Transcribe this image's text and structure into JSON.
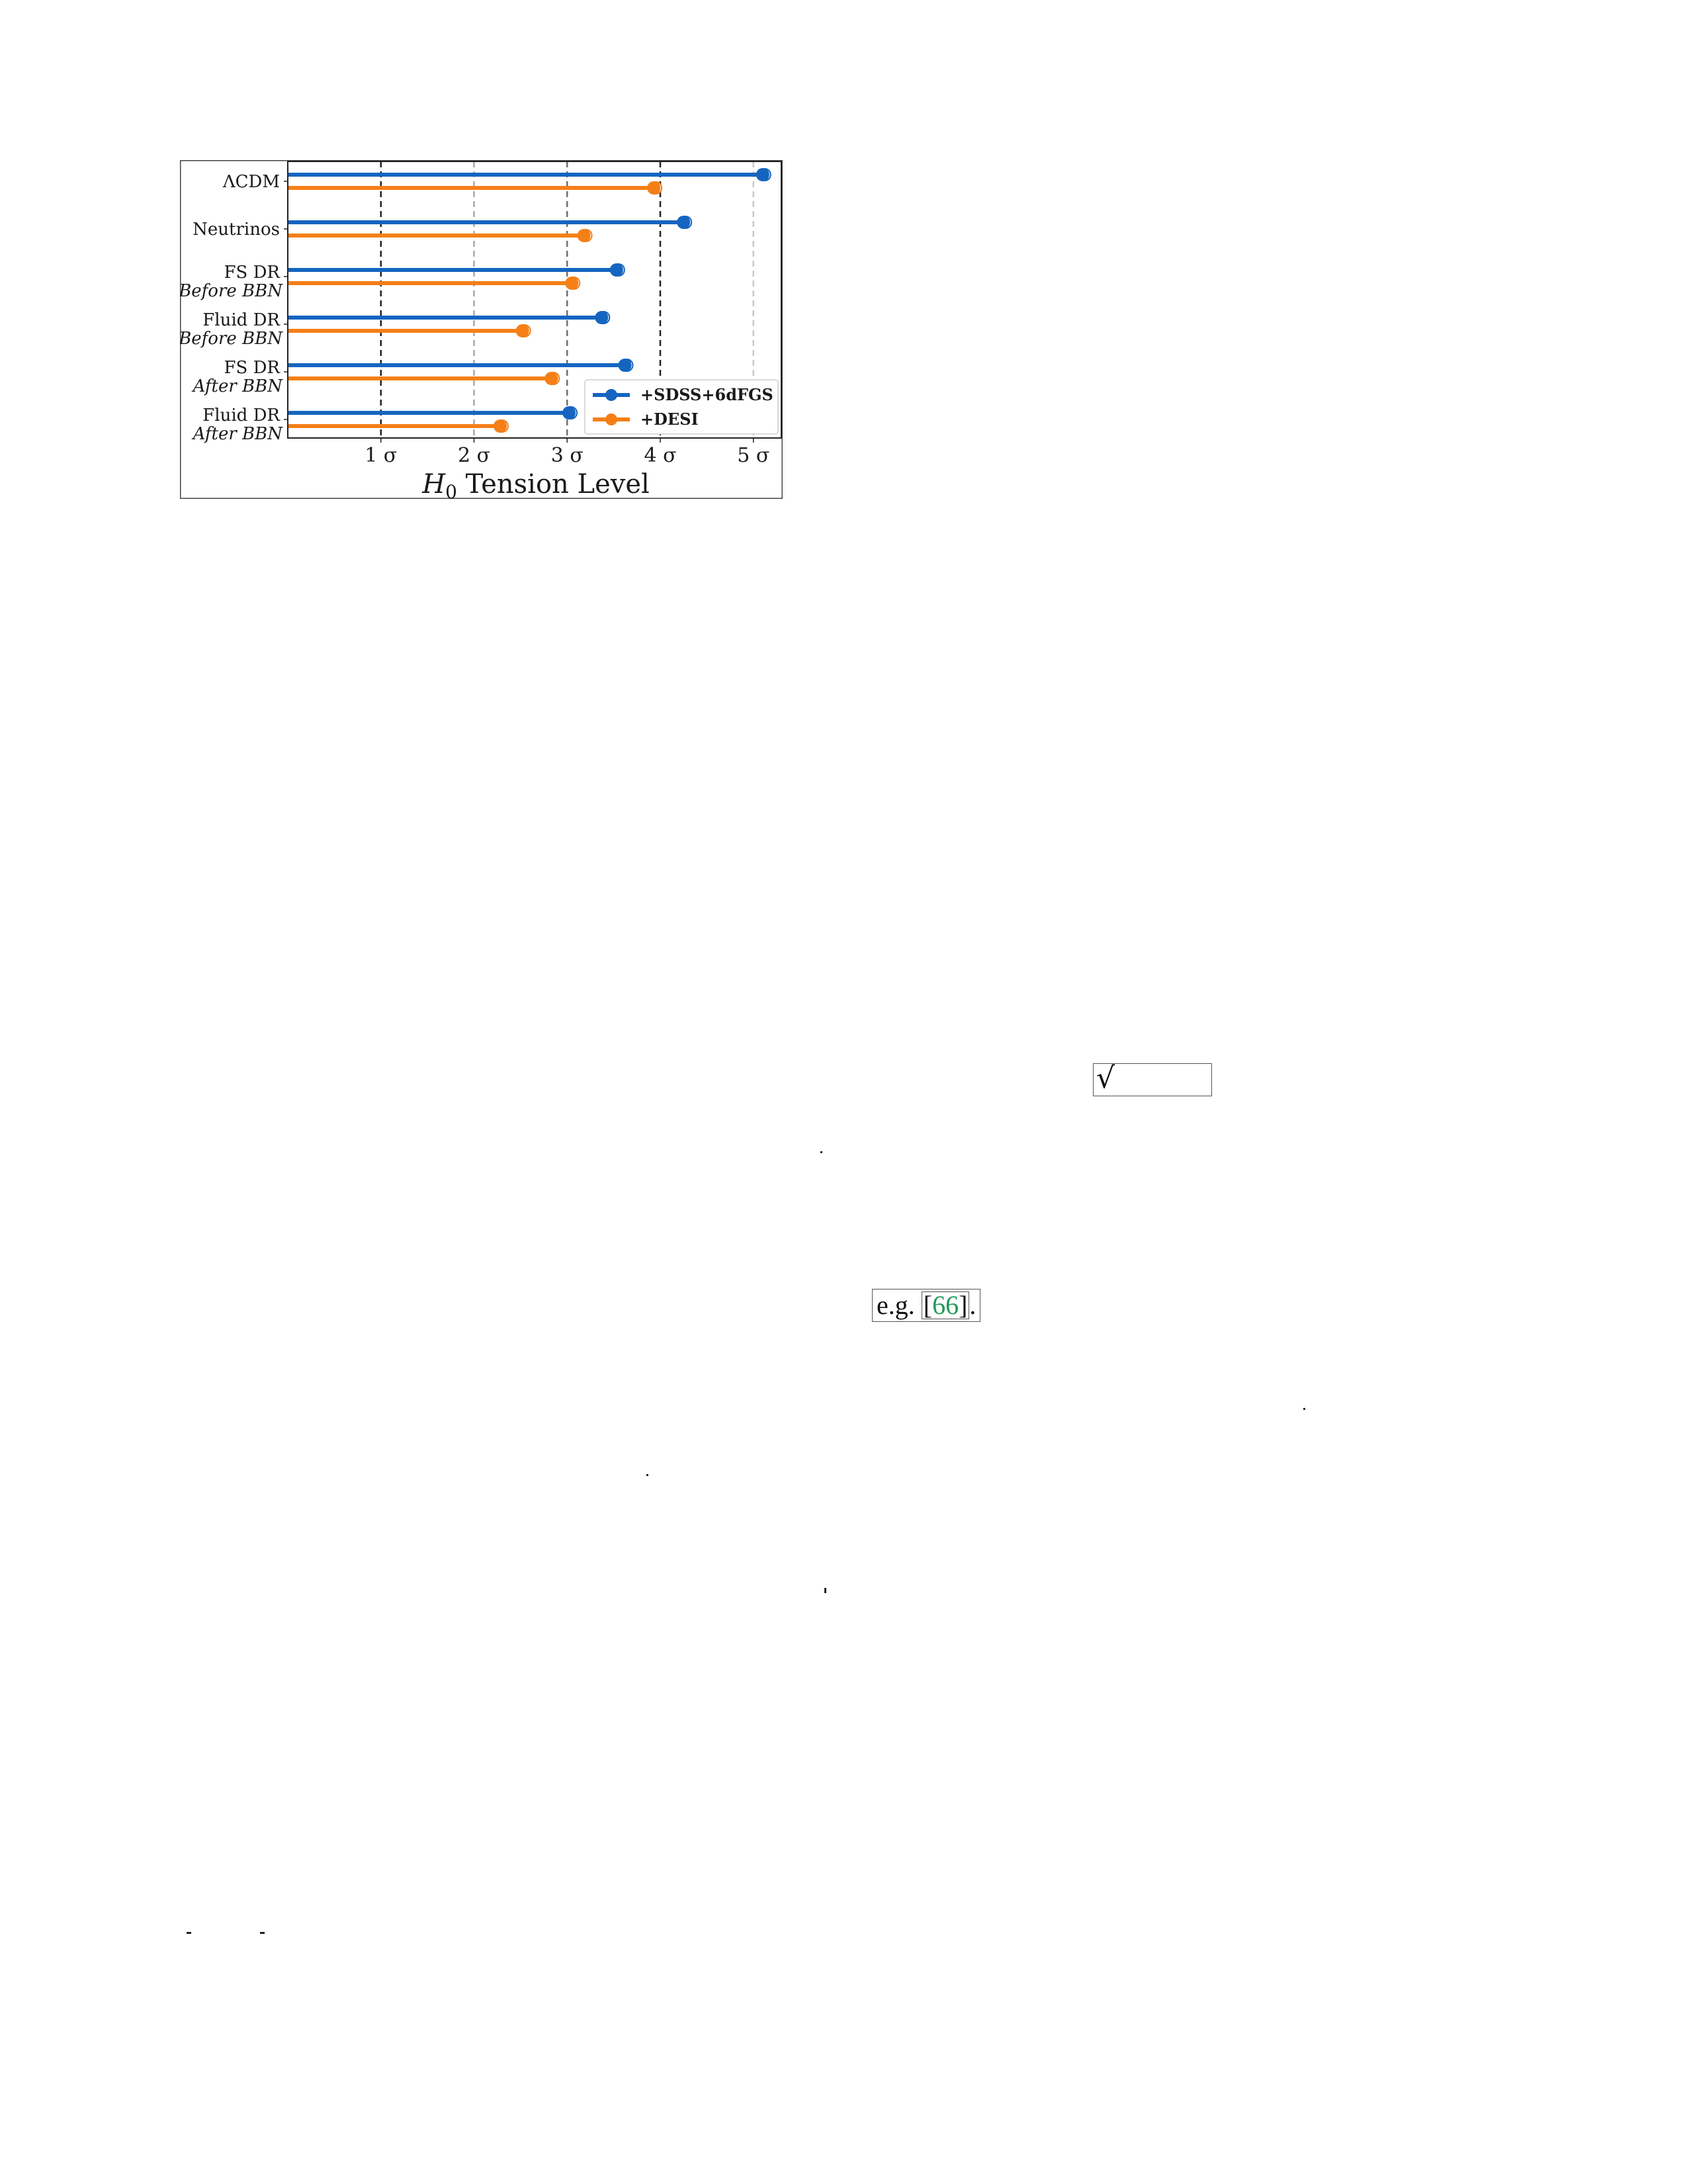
{
  "chart_data": {
    "type": "lollipop",
    "orientation": "horizontal",
    "categories": [
      {
        "line1": "ΛCDM",
        "line2": ""
      },
      {
        "line1": "Neutrinos",
        "line2": ""
      },
      {
        "line1": "FS DR",
        "line2": "Before BBN"
      },
      {
        "line1": "Fluid DR",
        "line2": "Before BBN"
      },
      {
        "line1": "FS DR",
        "line2": "After BBN"
      },
      {
        "line1": "Fluid DR",
        "line2": "After BBN"
      }
    ],
    "series": [
      {
        "name": "+SDSS+6dFGS",
        "color": "#1565c0",
        "values": [
          5.1,
          4.25,
          3.53,
          3.37,
          3.62,
          3.02
        ]
      },
      {
        "name": "+DESI",
        "color": "#f57f17",
        "values": [
          3.93,
          3.18,
          3.05,
          2.52,
          2.83,
          2.28
        ]
      }
    ],
    "xlim": [
      0,
      5.3
    ],
    "xticks": [
      "1 σ",
      "2 σ",
      "3 σ",
      "4 σ",
      "5 σ"
    ],
    "xtick_values": [
      1,
      2,
      3,
      4,
      5
    ],
    "xlabel_italic": "H",
    "xlabel_sub": "0",
    "xlabel_rest": " Tension Level",
    "reference_lines": [
      {
        "x": 1,
        "color": "#222222"
      },
      {
        "x": 2,
        "color": "#a8a8a8"
      },
      {
        "x": 3,
        "color": "#707070"
      },
      {
        "x": 4,
        "color": "#222222"
      },
      {
        "x": 5,
        "color": "#c8c8c8"
      }
    ],
    "legend_position": "bottom-right"
  },
  "fragments": {
    "sqrt": "√",
    "eg_text": "e.g. ",
    "eg_ref_open": "[",
    "eg_ref": "66",
    "eg_ref_close": "]",
    "eg_tail": "."
  }
}
